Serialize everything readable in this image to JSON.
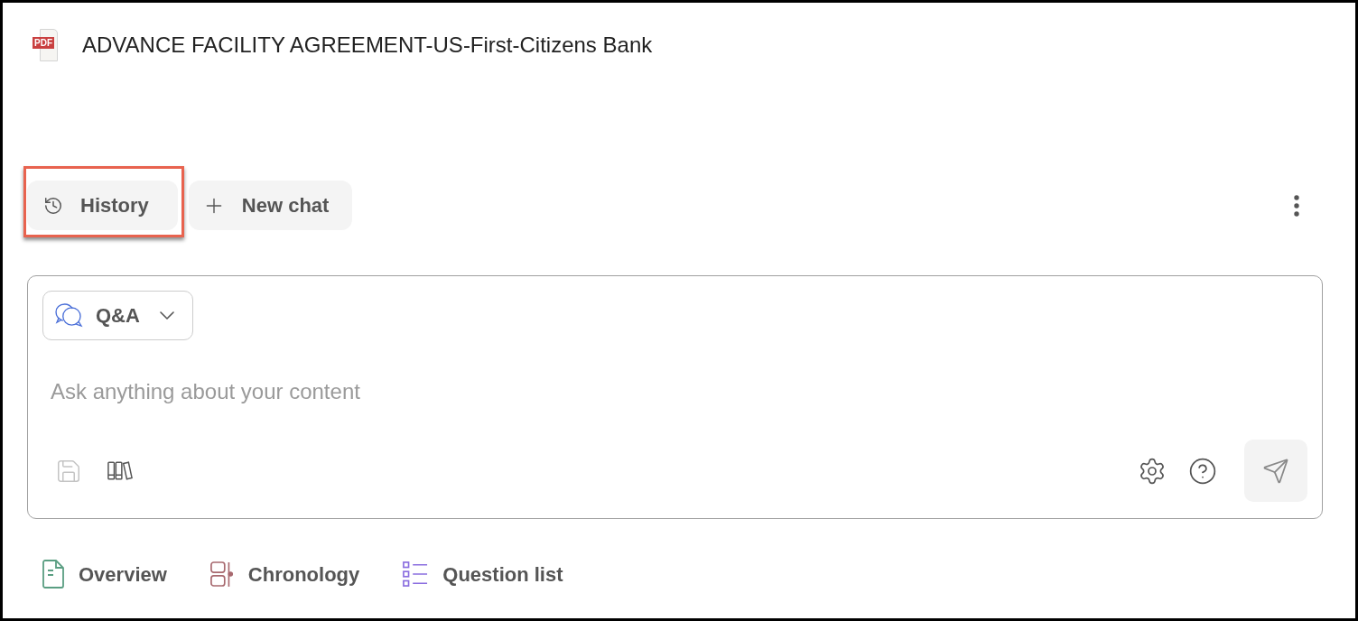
{
  "document": {
    "file_badge": "PDF",
    "title": "ADVANCE FACILITY AGREEMENT-US-First-Citizens Bank"
  },
  "toolbar": {
    "buttons": [
      {
        "kind": "history",
        "label": "History",
        "highlighted": true
      },
      {
        "kind": "new_chat",
        "label": "New chat",
        "highlighted": false
      }
    ]
  },
  "composer": {
    "mode": {
      "label": "Q&A"
    },
    "input": {
      "placeholder": "Ask anything about your content"
    },
    "tools_left": [
      {
        "kind": "save",
        "disabled": true
      },
      {
        "kind": "library",
        "disabled": false
      }
    ],
    "tools_right": [
      {
        "kind": "settings"
      },
      {
        "kind": "help"
      }
    ]
  },
  "quick_links": [
    {
      "kind": "overview",
      "label": "Overview",
      "color": "#5a9e82"
    },
    {
      "kind": "chronology",
      "label": "Chronology",
      "color": "#a8696f"
    },
    {
      "kind": "question_list",
      "label": "Question list",
      "color": "#8b6fe0"
    }
  ]
}
